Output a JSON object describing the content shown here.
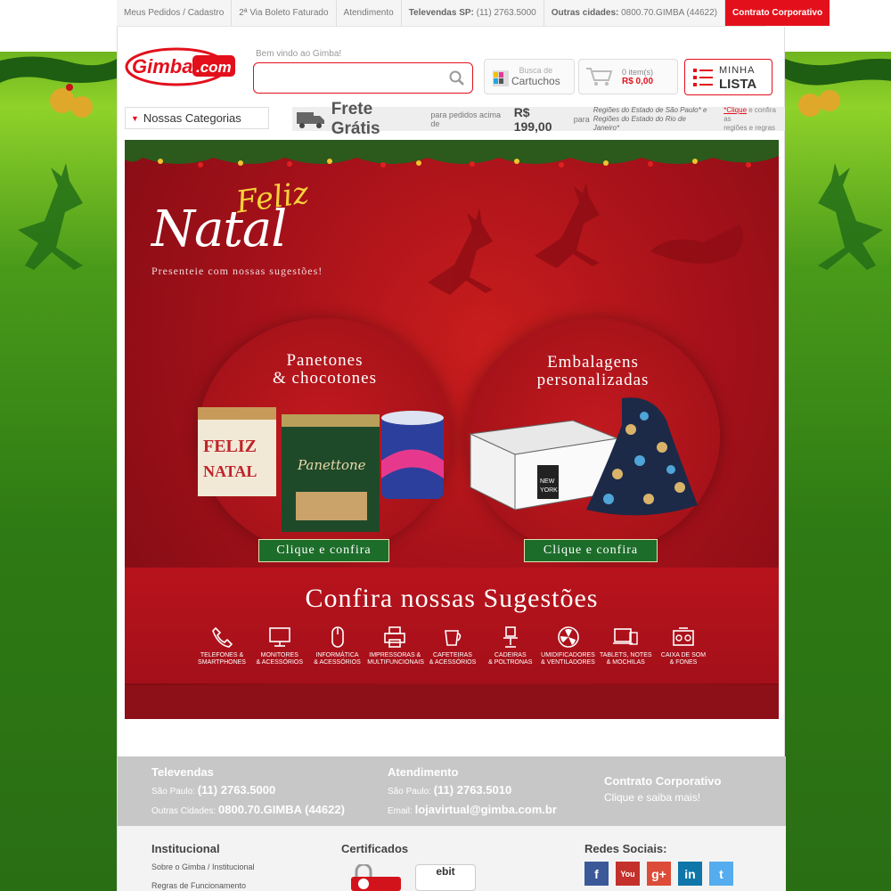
{
  "topbar": {
    "items": [
      "Meus Pedidos / Cadastro",
      "2ª Via Boleto Faturado",
      "Atendimento"
    ],
    "televendas_label": "Televendas SP:",
    "televendas_phone": "(11) 2763.5000",
    "outras_label": "Outras cidades:",
    "outras_phone": "0800.70.GIMBA (44622)",
    "corporate": "Contrato Corporativo"
  },
  "header": {
    "logo_text": "Gimba.com",
    "welcome": "Bem vindo ao Gimba!",
    "search": {
      "value": "",
      "placeholder": ""
    },
    "cartuchos_line1": "Busca de",
    "cartuchos_line2": "Cartuchos",
    "cart_items": "0 item(s)",
    "cart_total": "R$ 0,00",
    "lista_line1": "MINHA",
    "lista_line2": "LISTA"
  },
  "nav": {
    "categories": "Nossas Categorias",
    "frete_title": "Frete Grátis",
    "frete_pre": "para pedidos acima de",
    "frete_value": "R$ 199,00",
    "frete_post": "para",
    "frete_reg1": "Regiões do Estado de São Paulo* e",
    "frete_reg2": "Regiões do Estado do Rio de Janeiro*",
    "frete_click": "*Clique",
    "frete_click_rest": "e confira as",
    "frete_click2": "regiões e regras"
  },
  "banner": {
    "feliz": "Feliz",
    "natal": "Natal",
    "subtitle": "Presenteie com nossas sugestões!",
    "left_title1": "Panetones",
    "left_title2": "& chocotones",
    "left_cta": "Clique e confira",
    "right_title1": "Embalagens",
    "right_title2": "personalizadas",
    "right_cta": "Clique e confira",
    "sugestoes": "Confira nossas Sugestões",
    "categories": [
      {
        "l1": "TELEFONES &",
        "l2": "SMARTPHONES",
        "icon": "phone-icon"
      },
      {
        "l1": "MONITORES",
        "l2": "& ACESSÓRIOS",
        "icon": "monitor-icon"
      },
      {
        "l1": "INFORMÁTICA",
        "l2": "& ACESSÓRIOS",
        "icon": "mouse-icon"
      },
      {
        "l1": "IMPRESSORAS &",
        "l2": "MULTIFUNCIONAIS",
        "icon": "printer-icon"
      },
      {
        "l1": "CAFETEIRAS",
        "l2": "& ACESSÓRIOS",
        "icon": "coffee-maker-icon"
      },
      {
        "l1": "CADEIRAS",
        "l2": "& POLTRONAS",
        "icon": "chair-icon"
      },
      {
        "l1": "UMIDIFICADORES",
        "l2": "& VENTILADORES",
        "icon": "fan-icon"
      },
      {
        "l1": "TABLETS, NOTES",
        "l2": "& MOCHILAS",
        "icon": "tablet-icon"
      },
      {
        "l1": "CAIXA DE SOM",
        "l2": "& FONES",
        "icon": "speaker-icon"
      }
    ]
  },
  "footer": {
    "televendas_title": "Televendas",
    "sp_label": "São Paulo:",
    "sp_phone": "(11) 2763.5000",
    "outras_label": "Outras Cidades:",
    "outras_phone": "0800.70.GIMBA (44622)",
    "atend_title": "Atendimento",
    "atend_sp_label": "São Paulo:",
    "atend_sp_phone": "(11) 2763.5010",
    "email_label": "Email:",
    "email": "lojavirtual@gimba.com.br",
    "corp_title": "Contrato Corporativo",
    "corp_sub": "Clique e saiba mais!",
    "inst_title": "Institucional",
    "inst_links": [
      "Sobre o Gimba / Institucional",
      "Regras de Funcionamento"
    ],
    "cert_title": "Certificados",
    "cert_ebit": "ebit",
    "social_title": "Redes Sociais:",
    "social": [
      {
        "t": "f",
        "c": "#3b5998",
        "icon": "facebook-icon"
      },
      {
        "t": "You",
        "c": "#c4302b",
        "icon": "youtube-icon"
      },
      {
        "t": "g+",
        "c": "#dd4b39",
        "icon": "google-plus-icon"
      },
      {
        "t": "in",
        "c": "#0e76a8",
        "icon": "linkedin-icon"
      },
      {
        "t": "t",
        "c": "#55acee",
        "icon": "twitter-icon"
      }
    ]
  }
}
